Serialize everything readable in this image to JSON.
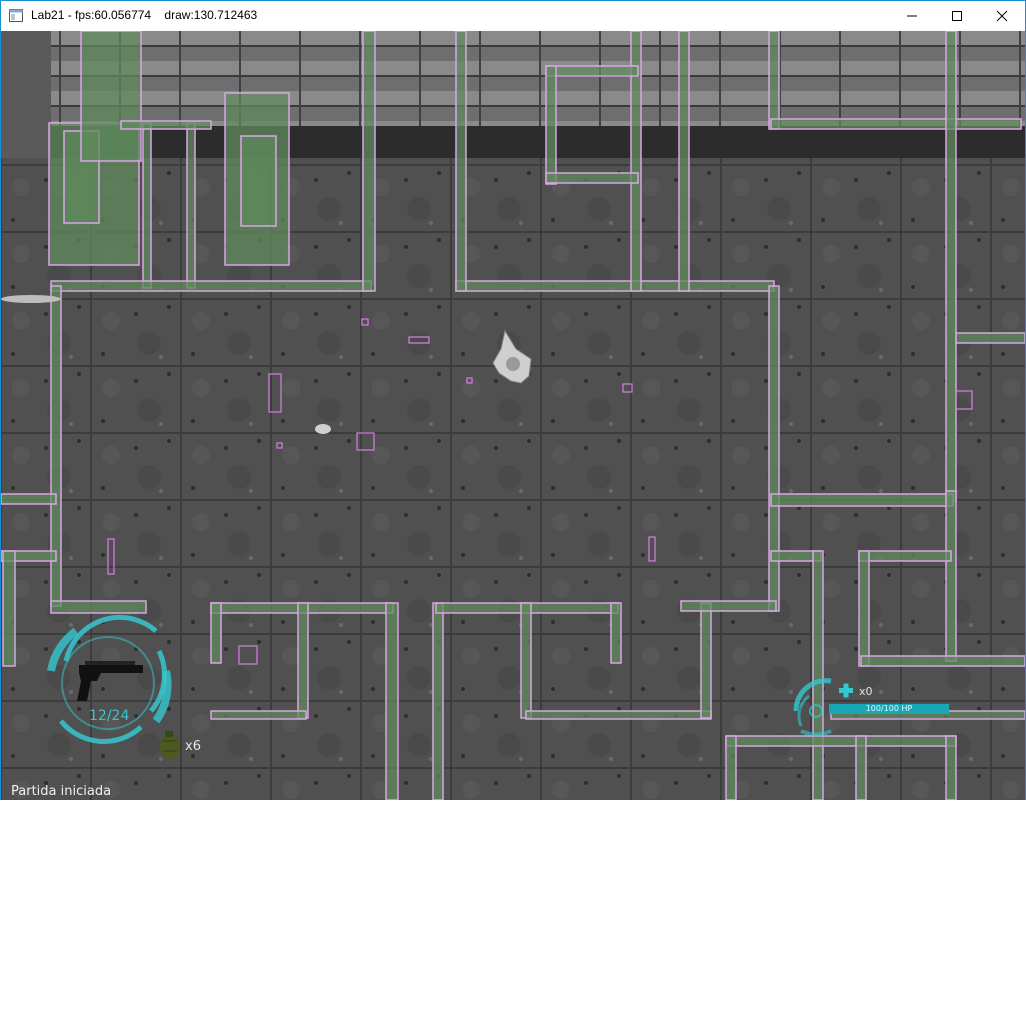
{
  "window": {
    "title": "Lab21 - fps:60.056774    draw:130.712463",
    "icon": "app-window-icon",
    "controls": {
      "minimize": "minimize-icon",
      "maximize": "maximize-icon",
      "close": "close-icon"
    }
  },
  "hud": {
    "weapon": {
      "icon": "pistol-icon",
      "ammo": "12/24"
    },
    "grenades": {
      "icon": "grenade-icon",
      "count": "x6"
    },
    "medkits": {
      "icon": "plus-icon",
      "count": "x0"
    },
    "health": {
      "label": "100/100 HP",
      "fraction": 1.0
    },
    "status_message": "Partida iniciada"
  },
  "colors": {
    "accent": "#35c7d0",
    "hp_bar": "#1aa7b5",
    "wall_outline": "#d9a6e6",
    "wall_fill": "#5f8a5c",
    "floor": "#4d4d4d"
  }
}
